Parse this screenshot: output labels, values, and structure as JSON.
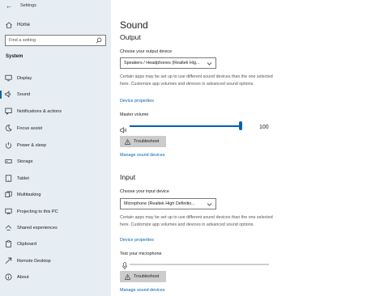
{
  "window": {
    "title": "Settings"
  },
  "sidebar": {
    "home_label": "Home",
    "search_placeholder": "Find a setting",
    "section_title": "System",
    "items": [
      {
        "label": "Display",
        "icon": "display-icon"
      },
      {
        "label": "Sound",
        "icon": "speaker-icon",
        "selected": true
      },
      {
        "label": "Notifications & actions",
        "icon": "notification-icon"
      },
      {
        "label": "Focus assist",
        "icon": "moon-icon"
      },
      {
        "label": "Power & sleep",
        "icon": "power-icon"
      },
      {
        "label": "Storage",
        "icon": "storage-icon"
      },
      {
        "label": "Tablet",
        "icon": "tablet-icon"
      },
      {
        "label": "Multitasking",
        "icon": "multitasking-icon"
      },
      {
        "label": "Projecting to this PC",
        "icon": "projector-icon"
      },
      {
        "label": "Shared experiences",
        "icon": "shared-icon"
      },
      {
        "label": "Clipboard",
        "icon": "clipboard-icon"
      },
      {
        "label": "Remote Desktop",
        "icon": "remote-desktop-icon"
      },
      {
        "label": "About",
        "icon": "info-icon"
      }
    ],
    "accent": "#0063b1"
  },
  "main": {
    "title": "Sound",
    "output": {
      "heading": "Output",
      "choose_label": "Choose your output device",
      "device_value": "Speakers / Headphones (Realtek Hig...",
      "description": "Certain apps may be set up to use different sound devices than the one selected here. Customize app volumes and devices in advanced sound options.",
      "properties_link": "Device properties",
      "master_volume_label": "Master volume",
      "volume_value": "100",
      "volume_level": 1.0,
      "troubleshoot_label": "Troubleshoot",
      "manage_link": "Manage sound devices"
    },
    "input": {
      "heading": "Input",
      "choose_label": "Choose your input device",
      "device_value": "Microphone (Realtek High Definitio...",
      "description": "Certain apps may be set up to use different sound devices than the one selected here. Customize app volumes and devices in advanced sound options.",
      "properties_link": "Device properties",
      "test_label": "Test your microphone",
      "mic_level": 0,
      "troubleshoot_label": "Troubleshoot",
      "manage_link": "Manage sound devices"
    }
  }
}
